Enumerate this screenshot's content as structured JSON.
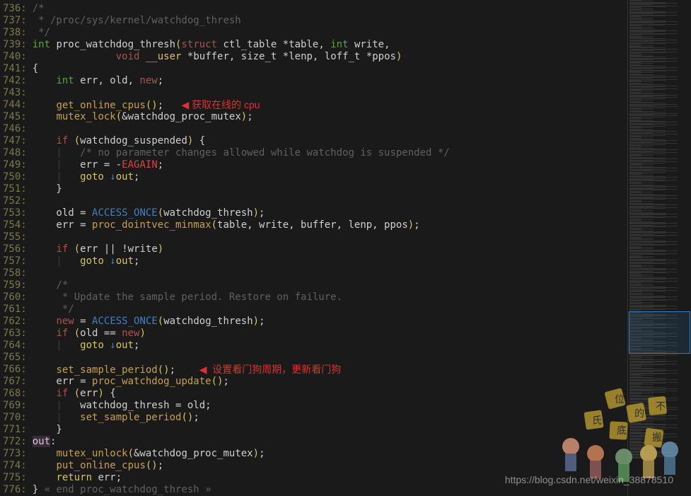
{
  "editor": {
    "startLine": 736,
    "lines": [
      {
        "num": "736:",
        "segments": [
          {
            "cls": "comment",
            "text": "/*"
          }
        ]
      },
      {
        "num": "737:",
        "segments": [
          {
            "cls": "comment",
            "text": " * /proc/sys/kernel/watchdog_thresh"
          }
        ]
      },
      {
        "num": "738:",
        "segments": [
          {
            "cls": "comment",
            "text": " */"
          }
        ]
      },
      {
        "num": "739:",
        "segments": [
          {
            "cls": "type",
            "text": "int"
          },
          {
            "cls": "identifier",
            "text": " "
          },
          {
            "cls": "identifier",
            "text": "proc_watchdog_thresh"
          },
          {
            "cls": "paren",
            "text": "("
          },
          {
            "cls": "keyword2",
            "text": "struct"
          },
          {
            "cls": "identifier",
            "text": " ctl_table "
          },
          {
            "cls": "operator",
            "text": "*"
          },
          {
            "cls": "identifier",
            "text": "table, "
          },
          {
            "cls": "type",
            "text": "int"
          },
          {
            "cls": "identifier",
            "text": " write,"
          }
        ]
      },
      {
        "num": "740:",
        "segments": [
          {
            "cls": "identifier",
            "text": "              "
          },
          {
            "cls": "keyword2",
            "text": "void"
          },
          {
            "cls": "identifier",
            "text": " "
          },
          {
            "cls": "constant3",
            "text": "__user"
          },
          {
            "cls": "identifier",
            "text": " "
          },
          {
            "cls": "operator",
            "text": "*"
          },
          {
            "cls": "identifier",
            "text": "buffer, size_t "
          },
          {
            "cls": "operator",
            "text": "*"
          },
          {
            "cls": "identifier",
            "text": "lenp, loff_t "
          },
          {
            "cls": "operator",
            "text": "*"
          },
          {
            "cls": "identifier",
            "text": "ppos"
          },
          {
            "cls": "paren",
            "text": ")"
          }
        ]
      },
      {
        "num": "741:",
        "segments": [
          {
            "cls": "identifier",
            "text": "{"
          }
        ]
      },
      {
        "num": "742:",
        "segments": [
          {
            "cls": "identifier",
            "text": "    "
          },
          {
            "cls": "type",
            "text": "int"
          },
          {
            "cls": "identifier",
            "text": " err, old, "
          },
          {
            "cls": "keyword2",
            "text": "new"
          },
          {
            "cls": "punct",
            "text": ";"
          }
        ]
      },
      {
        "num": "743:",
        "segments": [
          {
            "cls": "identifier",
            "text": ""
          }
        ]
      },
      {
        "num": "744:",
        "segments": [
          {
            "cls": "identifier",
            "text": "    "
          },
          {
            "cls": "func",
            "text": "get_online_cpus"
          },
          {
            "cls": "paren",
            "text": "()"
          },
          {
            "cls": "punct",
            "text": ";   "
          },
          {
            "cls": "arrow",
            "text": "◀"
          },
          {
            "cls": "annotation",
            "text": " 获取在线的 cpu"
          }
        ]
      },
      {
        "num": "745:",
        "segments": [
          {
            "cls": "identifier",
            "text": "    "
          },
          {
            "cls": "func",
            "text": "mutex_lock"
          },
          {
            "cls": "paren",
            "text": "("
          },
          {
            "cls": "operator",
            "text": "&"
          },
          {
            "cls": "identifier",
            "text": "watchdog_proc_mutex"
          },
          {
            "cls": "paren",
            "text": ")"
          },
          {
            "cls": "punct",
            "text": ";"
          }
        ]
      },
      {
        "num": "746:",
        "segments": [
          {
            "cls": "identifier",
            "text": ""
          }
        ]
      },
      {
        "num": "747:",
        "segments": [
          {
            "cls": "identifier",
            "text": "    "
          },
          {
            "cls": "keyword2",
            "text": "if"
          },
          {
            "cls": "identifier",
            "text": " "
          },
          {
            "cls": "paren",
            "text": "("
          },
          {
            "cls": "identifier",
            "text": "watchdog_suspended"
          },
          {
            "cls": "paren",
            "text": ")"
          },
          {
            "cls": "identifier",
            "text": " {"
          }
        ]
      },
      {
        "num": "748:",
        "segments": [
          {
            "cls": "guide",
            "text": "    |   "
          },
          {
            "cls": "comment",
            "text": "/* no parameter changes allowed while watchdog is suspended */"
          }
        ]
      },
      {
        "num": "749:",
        "segments": [
          {
            "cls": "guide",
            "text": "    |   "
          },
          {
            "cls": "identifier",
            "text": "err = "
          },
          {
            "cls": "operator",
            "text": "-"
          },
          {
            "cls": "const",
            "text": "EAGAIN"
          },
          {
            "cls": "punct",
            "text": ";"
          }
        ]
      },
      {
        "num": "750:",
        "segments": [
          {
            "cls": "guide",
            "text": "    |   "
          },
          {
            "cls": "return",
            "text": "goto"
          },
          {
            "cls": "identifier",
            "text": " "
          },
          {
            "cls": "down-arrow",
            "text": "↓"
          },
          {
            "cls": "constant3",
            "text": "out"
          },
          {
            "cls": "punct",
            "text": ";"
          }
        ]
      },
      {
        "num": "751:",
        "segments": [
          {
            "cls": "identifier",
            "text": "    }"
          }
        ]
      },
      {
        "num": "752:",
        "segments": [
          {
            "cls": "identifier",
            "text": ""
          }
        ]
      },
      {
        "num": "753:",
        "segments": [
          {
            "cls": "identifier",
            "text": "    old = "
          },
          {
            "cls": "func2",
            "text": "ACCESS_ONCE"
          },
          {
            "cls": "paren",
            "text": "("
          },
          {
            "cls": "identifier",
            "text": "watchdog_thresh"
          },
          {
            "cls": "paren",
            "text": ")"
          },
          {
            "cls": "punct",
            "text": ";"
          }
        ]
      },
      {
        "num": "754:",
        "segments": [
          {
            "cls": "identifier",
            "text": "    err = "
          },
          {
            "cls": "func",
            "text": "proc_dointvec_minmax"
          },
          {
            "cls": "paren",
            "text": "("
          },
          {
            "cls": "identifier",
            "text": "table, write, buffer, lenp, ppos"
          },
          {
            "cls": "paren",
            "text": ")"
          },
          {
            "cls": "punct",
            "text": ";"
          }
        ]
      },
      {
        "num": "755:",
        "segments": [
          {
            "cls": "identifier",
            "text": ""
          }
        ]
      },
      {
        "num": "756:",
        "segments": [
          {
            "cls": "identifier",
            "text": "    "
          },
          {
            "cls": "keyword2",
            "text": "if"
          },
          {
            "cls": "identifier",
            "text": " "
          },
          {
            "cls": "paren",
            "text": "("
          },
          {
            "cls": "identifier",
            "text": "err "
          },
          {
            "cls": "operator",
            "text": "||"
          },
          {
            "cls": "identifier",
            "text": " "
          },
          {
            "cls": "operator",
            "text": "!"
          },
          {
            "cls": "identifier",
            "text": "write"
          },
          {
            "cls": "paren",
            "text": ")"
          }
        ]
      },
      {
        "num": "757:",
        "segments": [
          {
            "cls": "guide",
            "text": "    |   "
          },
          {
            "cls": "return",
            "text": "goto"
          },
          {
            "cls": "identifier",
            "text": " "
          },
          {
            "cls": "down-arrow",
            "text": "↓"
          },
          {
            "cls": "constant3",
            "text": "out"
          },
          {
            "cls": "punct",
            "text": ";"
          }
        ]
      },
      {
        "num": "758:",
        "segments": [
          {
            "cls": "identifier",
            "text": ""
          }
        ]
      },
      {
        "num": "759:",
        "segments": [
          {
            "cls": "identifier",
            "text": "    "
          },
          {
            "cls": "comment",
            "text": "/*"
          }
        ]
      },
      {
        "num": "760:",
        "segments": [
          {
            "cls": "comment",
            "text": "     * Update the sample period. Restore on failure."
          }
        ]
      },
      {
        "num": "761:",
        "segments": [
          {
            "cls": "comment",
            "text": "     */"
          }
        ]
      },
      {
        "num": "762:",
        "segments": [
          {
            "cls": "identifier",
            "text": "    "
          },
          {
            "cls": "keyword2",
            "text": "new"
          },
          {
            "cls": "identifier",
            "text": " = "
          },
          {
            "cls": "func2",
            "text": "ACCESS_ONCE"
          },
          {
            "cls": "paren",
            "text": "("
          },
          {
            "cls": "identifier",
            "text": "watchdog_thresh"
          },
          {
            "cls": "paren",
            "text": ")"
          },
          {
            "cls": "punct",
            "text": ";"
          }
        ]
      },
      {
        "num": "763:",
        "segments": [
          {
            "cls": "identifier",
            "text": "    "
          },
          {
            "cls": "keyword2",
            "text": "if"
          },
          {
            "cls": "identifier",
            "text": " "
          },
          {
            "cls": "paren",
            "text": "("
          },
          {
            "cls": "identifier",
            "text": "old "
          },
          {
            "cls": "operator",
            "text": "=="
          },
          {
            "cls": "identifier",
            "text": " "
          },
          {
            "cls": "keyword2",
            "text": "new"
          },
          {
            "cls": "paren",
            "text": ")"
          }
        ]
      },
      {
        "num": "764:",
        "segments": [
          {
            "cls": "guide",
            "text": "    |   "
          },
          {
            "cls": "return",
            "text": "goto"
          },
          {
            "cls": "identifier",
            "text": " "
          },
          {
            "cls": "down-arrow",
            "text": "↓"
          },
          {
            "cls": "constant3",
            "text": "out"
          },
          {
            "cls": "punct",
            "text": ";"
          }
        ]
      },
      {
        "num": "765:",
        "segments": [
          {
            "cls": "identifier",
            "text": ""
          }
        ]
      },
      {
        "num": "766:",
        "segments": [
          {
            "cls": "identifier",
            "text": "    "
          },
          {
            "cls": "func",
            "text": "set_sample_period"
          },
          {
            "cls": "paren",
            "text": "()"
          },
          {
            "cls": "punct",
            "text": ";    "
          },
          {
            "cls": "arrow",
            "text": "◀"
          },
          {
            "cls": "annotation",
            "text": "  设置看门狗周期，更新看门狗"
          }
        ]
      },
      {
        "num": "767:",
        "segments": [
          {
            "cls": "identifier",
            "text": "    err = "
          },
          {
            "cls": "func",
            "text": "proc_watchdog_update"
          },
          {
            "cls": "paren",
            "text": "()"
          },
          {
            "cls": "punct",
            "text": ";"
          }
        ]
      },
      {
        "num": "768:",
        "segments": [
          {
            "cls": "identifier",
            "text": "    "
          },
          {
            "cls": "keyword2",
            "text": "if"
          },
          {
            "cls": "identifier",
            "text": " "
          },
          {
            "cls": "paren",
            "text": "("
          },
          {
            "cls": "identifier",
            "text": "err"
          },
          {
            "cls": "paren",
            "text": ")"
          },
          {
            "cls": "identifier",
            "text": " {"
          }
        ]
      },
      {
        "num": "769:",
        "segments": [
          {
            "cls": "guide",
            "text": "    |   "
          },
          {
            "cls": "identifier",
            "text": "watchdog_thresh = old;"
          }
        ]
      },
      {
        "num": "770:",
        "segments": [
          {
            "cls": "guide",
            "text": "    |   "
          },
          {
            "cls": "func",
            "text": "set_sample_period"
          },
          {
            "cls": "paren",
            "text": "()"
          },
          {
            "cls": "punct",
            "text": ";"
          }
        ]
      },
      {
        "num": "771:",
        "segments": [
          {
            "cls": "identifier",
            "text": "    }"
          }
        ]
      },
      {
        "num": "772:",
        "segments": [
          {
            "cls": "hl-out",
            "text": "out"
          },
          {
            "cls": "punct",
            "text": ":"
          }
        ]
      },
      {
        "num": "773:",
        "segments": [
          {
            "cls": "identifier",
            "text": "    "
          },
          {
            "cls": "func",
            "text": "mutex_unlock"
          },
          {
            "cls": "paren",
            "text": "("
          },
          {
            "cls": "operator",
            "text": "&"
          },
          {
            "cls": "identifier",
            "text": "watchdog_proc_mutex"
          },
          {
            "cls": "paren",
            "text": ")"
          },
          {
            "cls": "punct",
            "text": ";"
          }
        ]
      },
      {
        "num": "774:",
        "segments": [
          {
            "cls": "identifier",
            "text": "    "
          },
          {
            "cls": "func",
            "text": "put_online_cpus"
          },
          {
            "cls": "paren",
            "text": "()"
          },
          {
            "cls": "punct",
            "text": ";"
          }
        ]
      },
      {
        "num": "775:",
        "segments": [
          {
            "cls": "identifier",
            "text": "    "
          },
          {
            "cls": "return",
            "text": "return"
          },
          {
            "cls": "identifier",
            "text": " err;"
          }
        ]
      },
      {
        "num": "776:",
        "segments": [
          {
            "cls": "identifier",
            "text": "} "
          },
          {
            "cls": "comment",
            "text": "« end proc_watchdog_thresh »"
          }
        ]
      }
    ]
  },
  "watermark": "https://blog.csdn.net/weixin_38878510"
}
